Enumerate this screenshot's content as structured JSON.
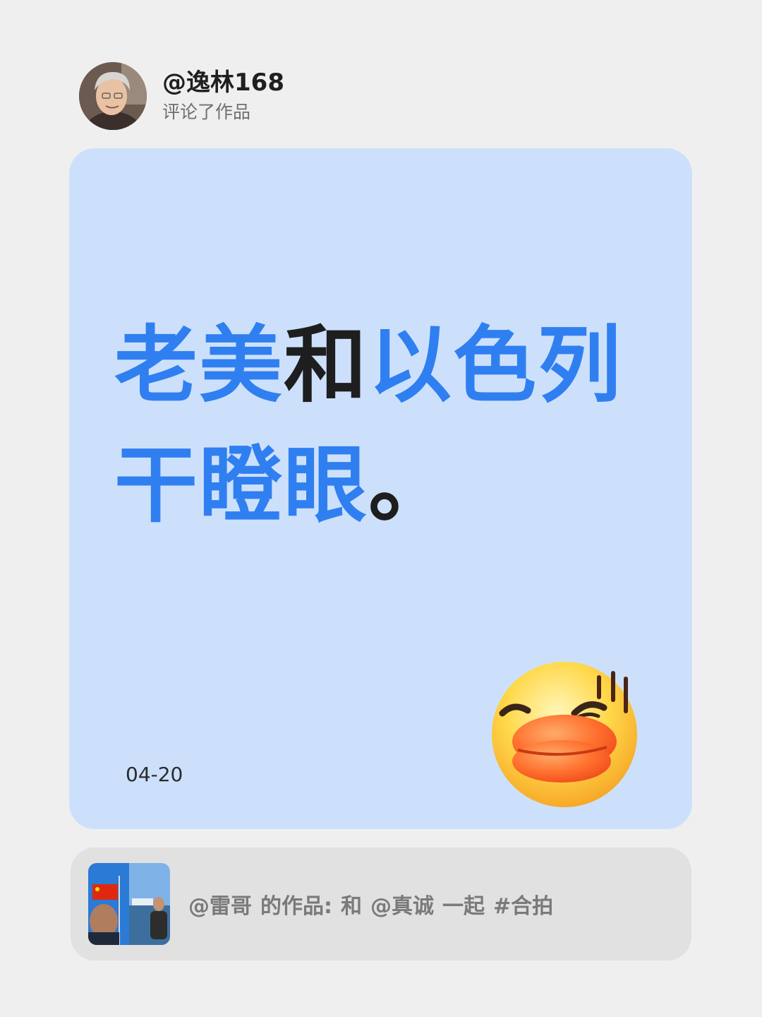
{
  "header": {
    "username": "@逸林168",
    "action": "评论了作品"
  },
  "card": {
    "background": "#cde0fb",
    "headline_segments": [
      {
        "text": "老美",
        "color": "#2f7ff1"
      },
      {
        "text": "和",
        "color": "#1e1e1e"
      },
      {
        "text": "以色列干瞪眼",
        "color": "#2f7ff1"
      },
      {
        "text": "。",
        "color": "#1e1e1e"
      }
    ],
    "date": "04-20",
    "emoji": "duck-face-emoji"
  },
  "share": {
    "author": "@雷哥",
    "of_work": "的作品:",
    "with_word": "和",
    "partner": "@真诚",
    "together": "一起",
    "hashtag": "#合拍"
  }
}
